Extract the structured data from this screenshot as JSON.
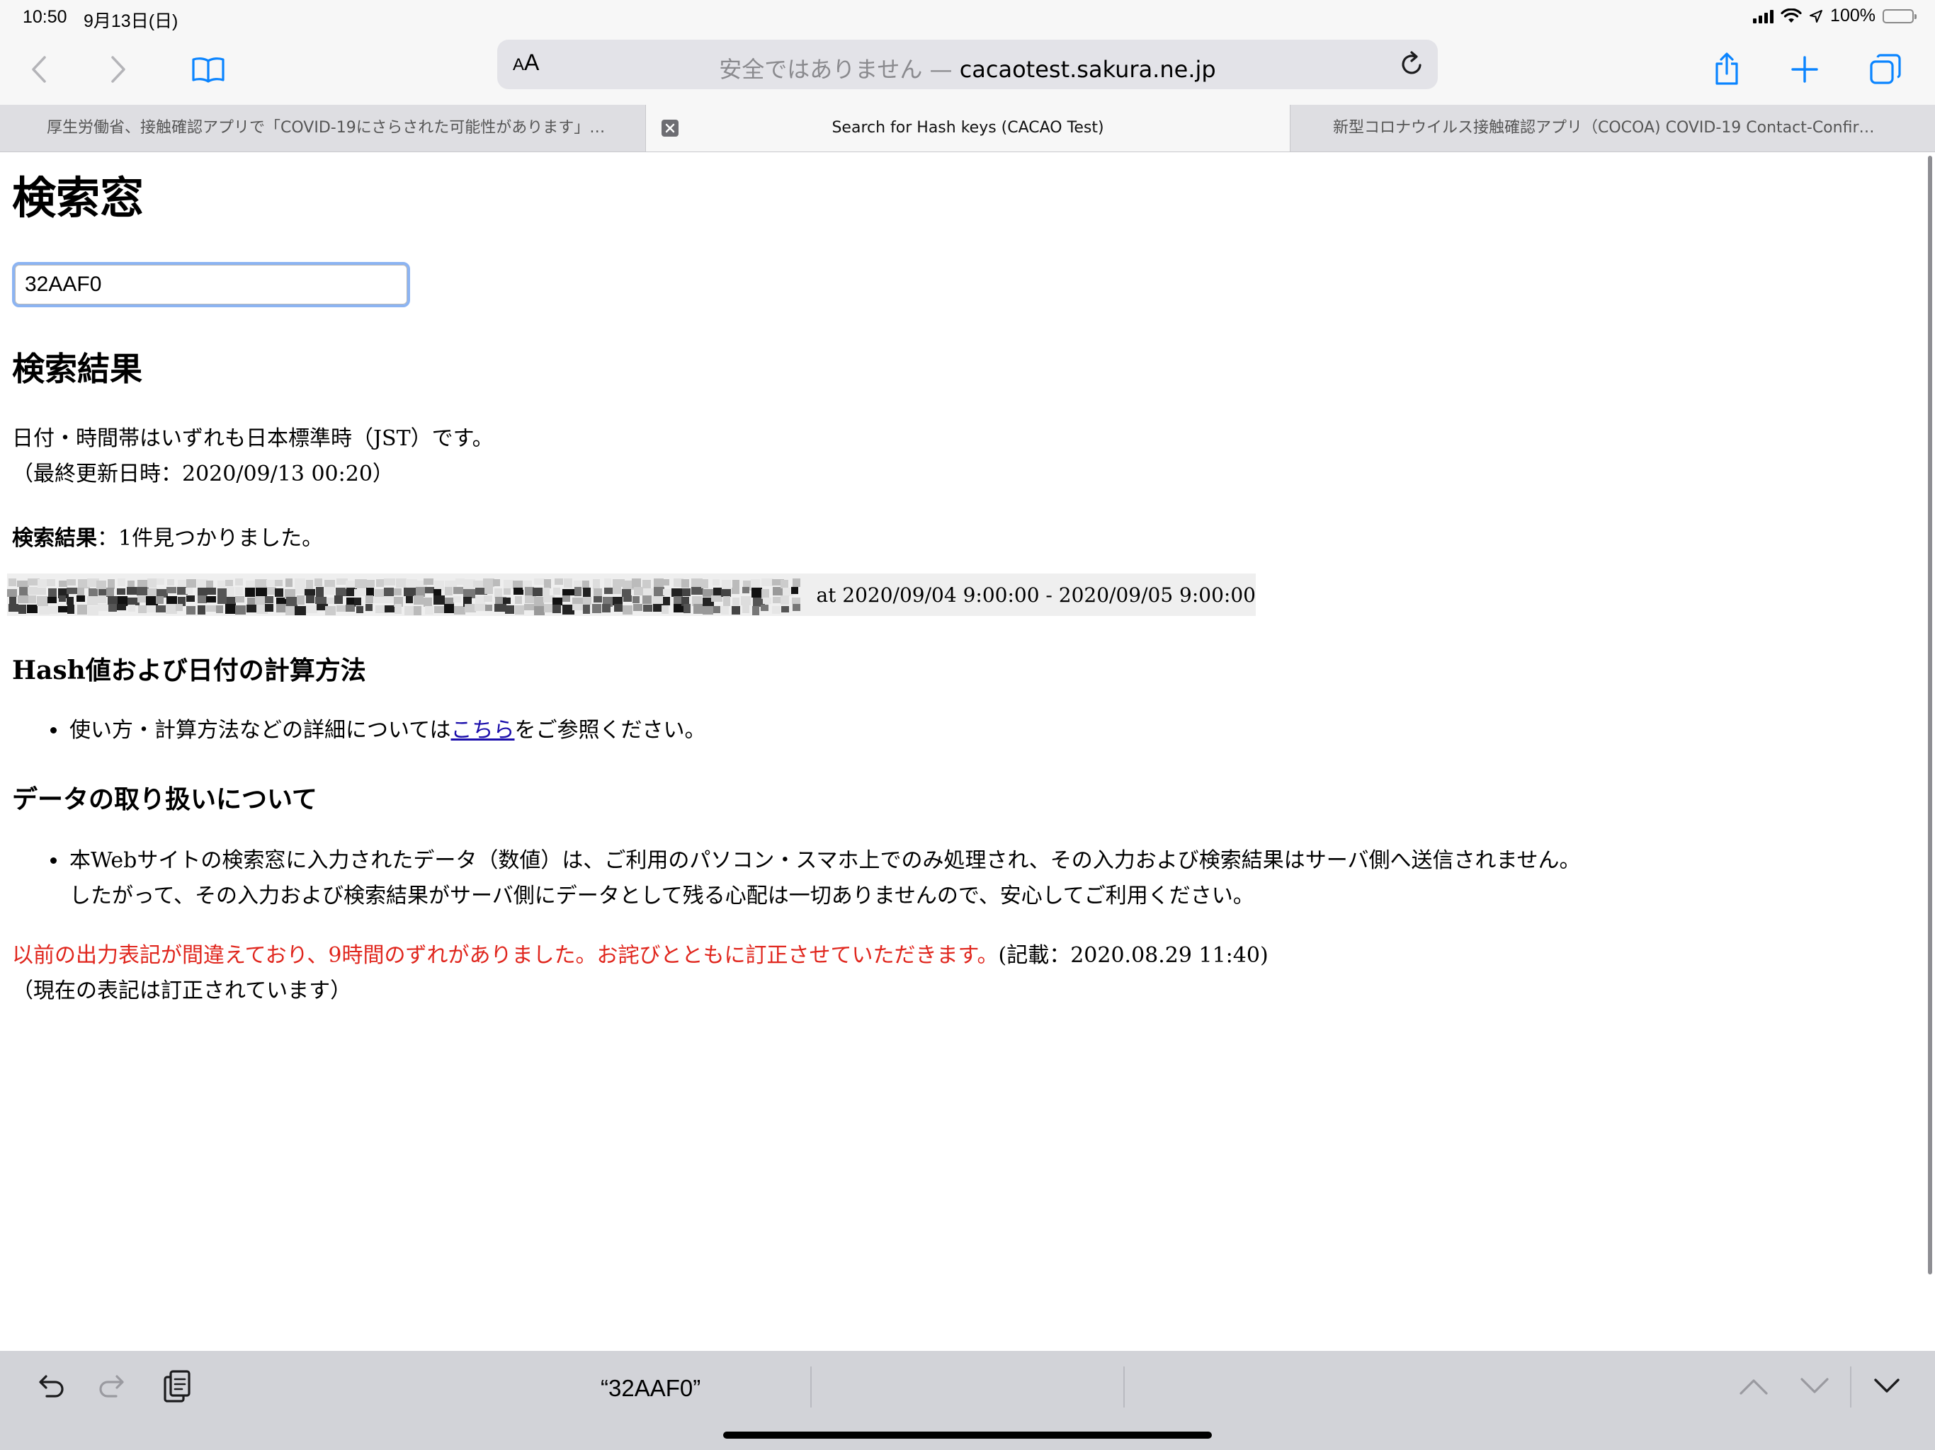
{
  "status_bar": {
    "time": "10:50",
    "date": "9月13日(日)",
    "battery": "100%",
    "battery_level": 1.0,
    "accent_green": "#34c759"
  },
  "toolbar": {
    "back_icon": "chevron-left-icon",
    "forward_icon": "chevron-right-icon",
    "bookmarks_icon": "book-icon",
    "share_icon": "share-icon",
    "new_tab_icon": "plus-icon",
    "tabs_icon": "tabs-overview-icon",
    "accent_blue": "#0a84ff"
  },
  "address_bar": {
    "aa_small": "A",
    "aa_big": "A",
    "insecure_label": "安全ではありません — ",
    "host": "cacaotest.sakura.ne.jp",
    "reload_icon": "reload-icon"
  },
  "tabs": [
    {
      "title": "厚生労働省、接触確認アプリで「COVID-19にさらされた可能性があります」…",
      "active": false
    },
    {
      "title": "Search for Hash keys (CACAO Test)",
      "active": true
    },
    {
      "title": "新型コロナウイルス接触確認アプリ（COCOA) COVID-19 Contact-Confir…",
      "active": false
    }
  ],
  "page": {
    "title": "検索窓",
    "search_value": "32AAF0",
    "results_heading": "検索結果",
    "tz_note_1": "日付・時間帯はいずれも日本標準時（JST）です。",
    "tz_note_2": "（最終更新日時：2020/09/13 00:20）",
    "result_count_label": "検索結果",
    "result_count_text": "：1件見つかりました。",
    "result_time": "at 2020/09/04 9:00:00 - 2020/09/05 9:00:00",
    "method_heading": "Hash値および日付の計算方法",
    "method_before": "使い方・計算方法などの詳細については",
    "method_link": "こちら",
    "method_after": "をご参照ください。",
    "data_heading": "データの取り扱いについて",
    "data_line_1": "本Webサイトの検索窓に入力されたデータ（数値）は、ご利用のパソコン・スマホ上でのみ処理され、その入力および検索結果はサーバ側へ送信されません。",
    "data_line_2": "したがって、その入力および検索結果がサーバ側にデータとして残る心配は一切ありませんので、安心してご利用ください。",
    "notice_red": "以前の出力表記が間違えており、9時間のずれがありました。お詫びとともに訂正させていただきます。",
    "notice_date": "(記載：2020.08.29 11:40)",
    "notice_line_2": "（現在の表記は訂正されています）",
    "link_color": "#1a0dab",
    "notice_color": "#e0261d"
  },
  "keyboard_bar": {
    "undo_icon": "undo-icon",
    "redo_icon": "redo-icon",
    "paste_icon": "clipboard-icon",
    "suggestion": "“32AAF0”",
    "prev_icon": "chevron-up-icon",
    "next_icon": "chevron-down-icon",
    "dismiss_icon": "chevron-down-icon"
  }
}
